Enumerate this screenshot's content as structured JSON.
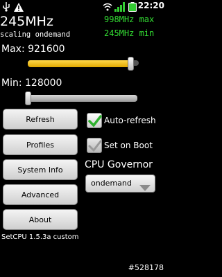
{
  "statusbar": {
    "time": "22:20",
    "left_icons": [
      "usb-icon",
      "warning-icon"
    ],
    "right_icons": [
      "wifi-icon",
      "signal-icon",
      "battery-icon"
    ]
  },
  "header": {
    "current_freq": "245MHz",
    "scaling": "scaling ondemand",
    "max_freq": "998MHz max",
    "min_freq": "245MHz min"
  },
  "sliders": {
    "max": {
      "label": "Max: 921600",
      "level": 0.93,
      "color": "#f5c400"
    },
    "min": {
      "label": "Min: 128000",
      "level": 0.0,
      "color": "#aaaaaa"
    }
  },
  "buttons": {
    "refresh": "Refresh",
    "profiles": "Profiles",
    "system_info": "System Info",
    "advanced": "Advanced",
    "about": "About"
  },
  "checkboxes": {
    "auto_refresh": {
      "label": "Auto-refresh",
      "checked": true
    },
    "set_on_boot": {
      "label": "Set on Boot",
      "checked": false
    }
  },
  "governor": {
    "title": "CPU Governor",
    "selected": "ondemand"
  },
  "footer": {
    "version": "SetCPU 1.5.3a custom",
    "image_id": "#528178"
  },
  "colors": {
    "green_text": "#33dd33",
    "check_green": "#2fb12f",
    "slider_yellow": "#f5c400"
  }
}
